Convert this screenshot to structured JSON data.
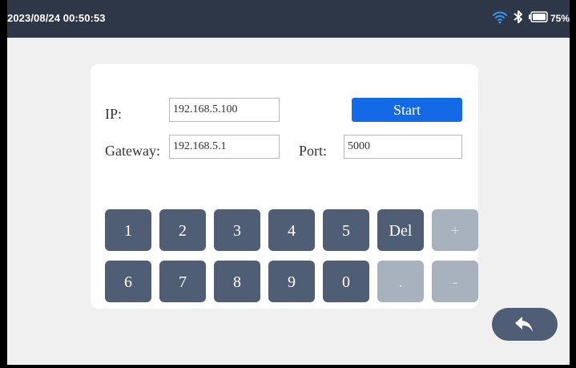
{
  "status": {
    "datetime": "2023/08/24 00:50:53",
    "battery_percent": "75%",
    "battery_level": 0.75,
    "icons": [
      "wifi-icon",
      "bluetooth-icon",
      "battery-icon"
    ]
  },
  "form": {
    "ip_label": "IP:",
    "ip_value": "192.168.5.100",
    "gateway_label": "Gateway:",
    "gateway_value": "192.168.5.1",
    "port_label": "Port:",
    "port_value": "5000",
    "start_label": "Start"
  },
  "keypad": {
    "row1": [
      "1",
      "2",
      "3",
      "4",
      "5",
      "Del",
      "+"
    ],
    "row2": [
      "6",
      "7",
      "8",
      "9",
      "0",
      ".",
      "-"
    ]
  },
  "back": {
    "icon": "back-arrow-icon"
  },
  "colors": {
    "statusbar": "#2d3748",
    "accent": "#1469e6",
    "key": "#4f5e74",
    "key_disabled": "#a8b2be"
  }
}
